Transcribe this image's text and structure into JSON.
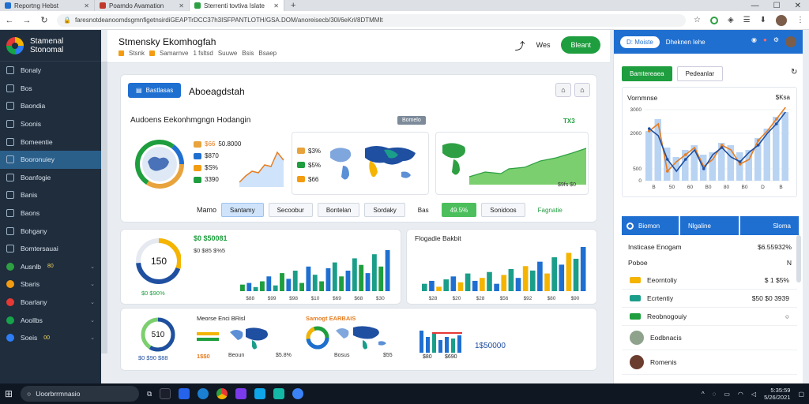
{
  "browser": {
    "tabs": [
      {
        "label": "Reportng Hebst",
        "color": "#1f6fd1"
      },
      {
        "label": "Poamdo Avamation",
        "color": "#c0392b"
      },
      {
        "label": "Sterrenti tovtiva Islate",
        "color": "#2ea043"
      }
    ],
    "url": "faresnotdeanoomdsgmnfigetnsirdiGEAPTrDCC37h3ISFPANTLOTH/GSA.DOM/anoreisecb/30l/6eKrl/8DTMMlt",
    "controls": {
      "minimize": "—",
      "maximize": "☐",
      "close": "✕"
    }
  },
  "sidebar": {
    "brand_line1": "Stamenal",
    "brand_line2": "Stonomal",
    "items": [
      {
        "label": "Bonaly",
        "active": false
      },
      {
        "label": "Bos",
        "active": false
      },
      {
        "label": "Baondia",
        "active": false
      },
      {
        "label": "Soonis",
        "active": false
      },
      {
        "label": "Bomeentie",
        "active": false
      },
      {
        "label": "Booronuiey",
        "active": true
      },
      {
        "label": "Boanfogie",
        "active": false
      },
      {
        "label": "Banis",
        "active": false
      },
      {
        "label": "Baons",
        "active": false
      },
      {
        "label": "Bohgany",
        "active": false
      },
      {
        "label": "Bomtersauai",
        "active": false
      },
      {
        "label": "Ausnlb",
        "badge": "80",
        "color": "#2ea043"
      },
      {
        "label": "Sbaris",
        "color": "#f39c12"
      },
      {
        "label": "Boarlany",
        "color": "#e53935"
      },
      {
        "label": "Aoollbs",
        "color": "#16a34a"
      },
      {
        "label": "Soeis",
        "badge": "00",
        "color": "#2e7df6"
      }
    ]
  },
  "header": {
    "title": "Stmensky Ekomhogfah",
    "crumbs": [
      "Stsnk",
      "Samarnve",
      "1 fsltsd",
      "Suuwe",
      "Bsis",
      "Bsaep"
    ],
    "action_label": "Wes",
    "button_label": "Bleant"
  },
  "main": {
    "report_button": "Bastlasas",
    "report_title": "Aboeagdstah",
    "overview_title": "Audoens Eekonhmgngn Hodangin",
    "overview_tag": "Bomelo",
    "overview_badge": "TX3",
    "donut_legend": [
      {
        "label": "50.8000",
        "color": "#e8a33c"
      },
      {
        "label": "$870",
        "color": "#1f6fd1"
      },
      {
        "label": "$S%",
        "color": "#f39c12"
      },
      {
        "label": "3390",
        "color": "#1e9e3e"
      }
    ],
    "donut_legend_prefix": "$66",
    "map_legend": [
      {
        "label": "$3%",
        "color": "#e8a33c"
      },
      {
        "label": "$5%",
        "color": "#1e9e3e"
      },
      {
        "label": "$66",
        "color": "#f39c12"
      }
    ],
    "map_caption": "$9fs $0",
    "filter_label": "Mamo",
    "filters": [
      {
        "label": "Santamy",
        "state": "selected"
      },
      {
        "label": "Secoobur",
        "state": ""
      },
      {
        "label": "Bontelan",
        "state": ""
      },
      {
        "label": "Sordaky",
        "state": ""
      },
      {
        "label": "Bas",
        "state": "plain"
      },
      {
        "label": "49.5%",
        "state": "green"
      },
      {
        "label": "Sonidoos",
        "state": ""
      },
      {
        "label": "Fagnatie",
        "state": "plain-green"
      }
    ],
    "gauge_value": "150",
    "gauge_caption": "$0 $90%",
    "bars1_title": "$0 $50081",
    "bars1_sub": "$0 $85 $%5",
    "bars1_ticks": [
      "$88",
      "$99",
      "$98",
      "$10",
      "$69",
      "$68",
      "$30"
    ],
    "bars2_title": "Flogadie Bakbit",
    "bars2_ticks": [
      "$28",
      "$20",
      "$28",
      "$56",
      "$92",
      "$80",
      "$90"
    ],
    "gauge2_value": "510",
    "gauge2_caption": "$0 $90 $88",
    "mini1_title": "Meorse Enci BRisl",
    "mini1_caption": "1$$0",
    "mini1_caption2": "Beoun",
    "mini1_val": "$5.8%",
    "mini2_title": "Samogt EARBAIS",
    "mini2_caption": "Bosus",
    "mini2_val": "$55",
    "mini3_val": "1$50000",
    "mini3_ticks": [
      "$80",
      "$690"
    ]
  },
  "right": {
    "head_pill": "D: Moiste",
    "head_text": "Dheknen Iehe",
    "btn_green": "Bamtereaea",
    "btn_plain": "Pedeanlar",
    "chart_title": "Vornmnse",
    "chart_icons": "$Ksa",
    "chart_yticks": [
      "3000",
      "2000",
      "500",
      "0"
    ],
    "chart_xticks": [
      "B",
      "50",
      "60",
      "B0",
      "80",
      "B0",
      "D",
      "B"
    ],
    "tabs": [
      {
        "label": "Biomon",
        "style": "primary"
      },
      {
        "label": "Nlgaline",
        "style": "primary"
      },
      {
        "label": "Sloma",
        "style": "primary"
      }
    ],
    "summary_label": "Insticase Enogam",
    "summary_value": "$6.55932%",
    "summary_sub": "Poboe",
    "summary_sub_val": "N",
    "rows": [
      {
        "label": "Eeorntoliy",
        "value": "$ 1 $5%",
        "color": "#f4b400"
      },
      {
        "label": "Ecrtentiy",
        "value": "$50 $0 3939",
        "color": "#1a9e8a"
      },
      {
        "label": "Reobnogouiy",
        "value": "○",
        "color": "#1e9e3e"
      },
      {
        "label": "Eodbnacis",
        "value": "",
        "avatar": "#8fa38c"
      },
      {
        "label": "Romenis",
        "value": "",
        "avatar": "#6b3d2e"
      }
    ]
  },
  "taskbar": {
    "search": "Uoorbrrmnasio",
    "time": "5:35:59",
    "date": "5/26/2021"
  },
  "chart_data": [
    {
      "type": "line",
      "title": "Vornmnse",
      "x": [
        "B",
        "50",
        "60",
        "B0",
        "80",
        "B0",
        "D",
        "B"
      ],
      "ylim": [
        0,
        3000
      ],
      "series": [
        {
          "values": [
            2100,
            2400,
            400,
            800,
            1100,
            1400,
            600,
            900,
            1500,
            1300,
            700,
            900,
            1700,
            2100,
            2600,
            3100
          ],
          "color": "#e67e22"
        },
        {
          "values": [
            2200,
            1900,
            900,
            400,
            900,
            1300,
            500,
            1100,
            1400,
            1000,
            800,
            1200,
            1500,
            2000,
            2400,
            2900
          ],
          "color": "#1f4fa0"
        }
      ],
      "bars": [
        2100,
        2600,
        1400,
        1000,
        1300,
        1500,
        1100,
        1200,
        1600,
        1500,
        1200,
        1300,
        1800,
        2200,
        2700,
        2900
      ]
    },
    {
      "type": "bar",
      "title": "$0 $50081",
      "values": [
        8,
        10,
        5,
        12,
        18,
        7,
        22,
        15,
        25,
        10,
        30,
        20,
        12,
        28,
        35,
        18,
        25,
        40,
        32,
        22,
        45,
        30,
        50
      ],
      "colors": [
        "#1e9e3e",
        "#1f6fd1",
        "#1a9e8a"
      ]
    },
    {
      "type": "bar",
      "title": "Flogadie Bakbit",
      "values": [
        10,
        14,
        6,
        16,
        20,
        12,
        24,
        14,
        18,
        26,
        10,
        22,
        30,
        18,
        34,
        28,
        40,
        24,
        46,
        36,
        52,
        44,
        60
      ],
      "colors": [
        "#1a9e8a",
        "#1f6fd1",
        "#f4b400"
      ]
    }
  ]
}
